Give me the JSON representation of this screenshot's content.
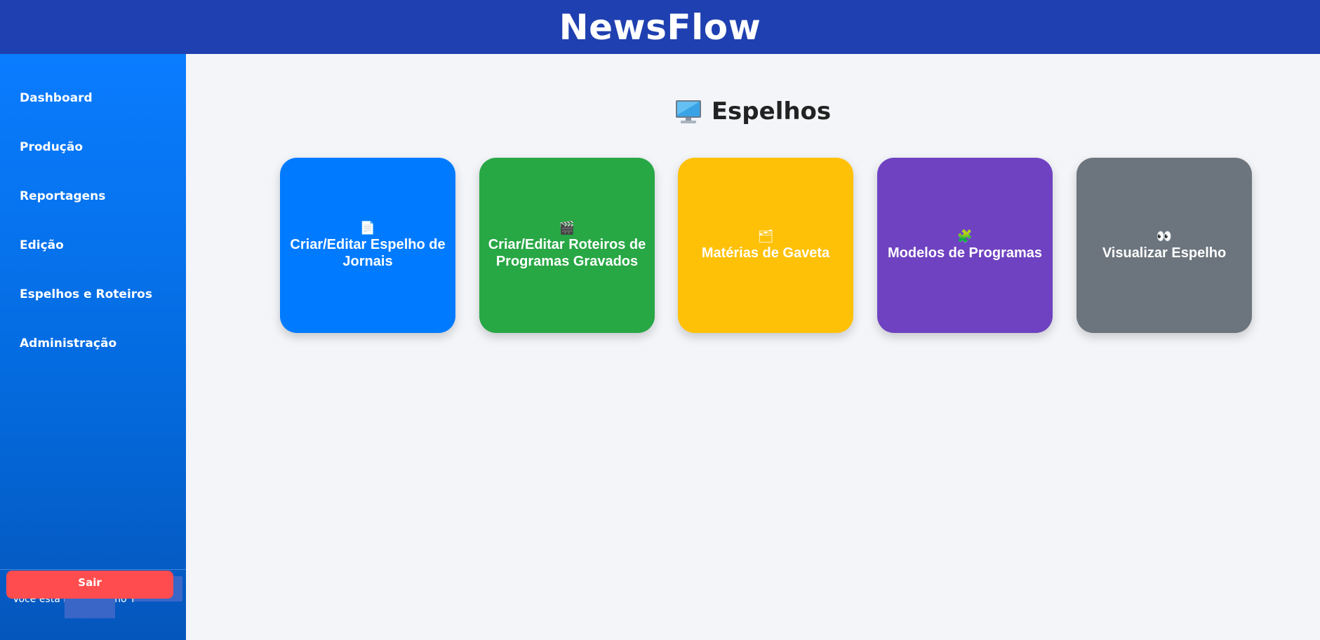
{
  "header": {
    "brand": "NewsFlow"
  },
  "sidebar": {
    "items": [
      {
        "label": "Dashboard"
      },
      {
        "label": "Produção"
      },
      {
        "label": "Reportagens"
      },
      {
        "label": "Edição"
      },
      {
        "label": "Espelhos e Roteiros"
      },
      {
        "label": "Administração"
      }
    ],
    "logged_in_text": "Você está logado como T",
    "logout_label": "Sair"
  },
  "main": {
    "title": "Espelhos",
    "title_icon": "desktop-computer-icon",
    "cards": [
      {
        "label": "Criar/Editar Espelho de Jornais",
        "icon": "📄",
        "icon_name": "page-icon",
        "color": "#007bff"
      },
      {
        "label": "Criar/Editar Roteiros de Programas Gravados",
        "icon": "🎬",
        "icon_name": "clapper-board-icon",
        "color": "#28a745"
      },
      {
        "label": "Matérias de Gaveta",
        "icon": "🗂",
        "icon_name": "folder-icon",
        "color": "#ffc107"
      },
      {
        "label": "Modelos de Programas",
        "icon": "🧩",
        "icon_name": "puzzle-piece-icon",
        "color": "#6f42c1"
      },
      {
        "label": "Visualizar Espelho",
        "icon": "👀",
        "icon_name": "eyes-icon",
        "color": "#6c757d"
      }
    ]
  }
}
